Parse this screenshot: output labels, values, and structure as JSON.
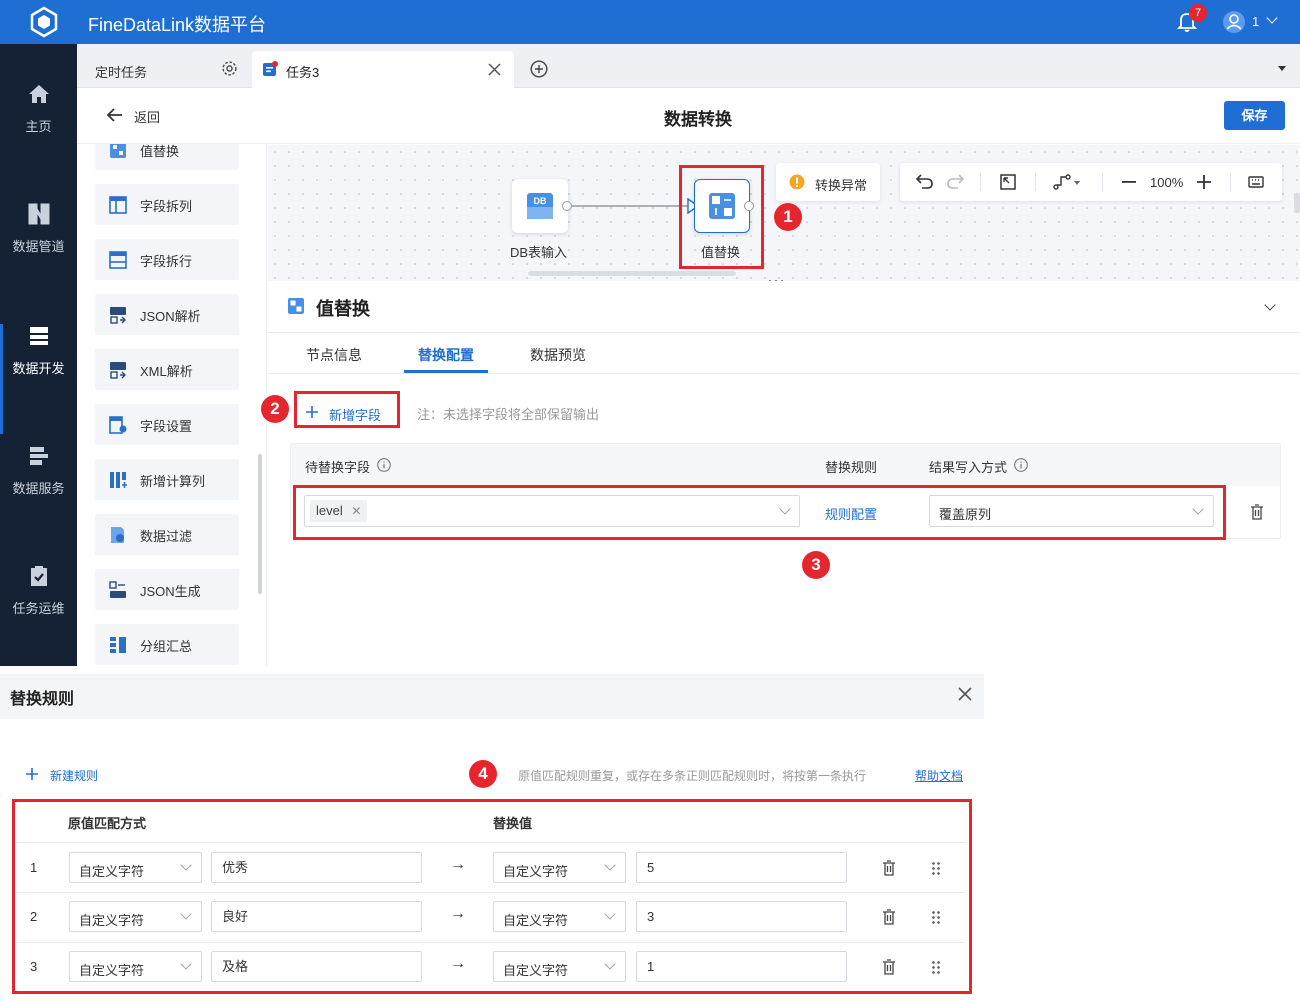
{
  "app": {
    "title": "FineDataLink数据平台",
    "notification_count": "7",
    "user": "1"
  },
  "nav": {
    "items": [
      {
        "label": "主页",
        "icon": "home-icon"
      },
      {
        "label": "数据管道",
        "icon": "pipeline-icon"
      },
      {
        "label": "数据开发",
        "icon": "dev-icon",
        "active": true
      },
      {
        "label": "数据服务",
        "icon": "service-icon"
      },
      {
        "label": "任务运维",
        "icon": "ops-icon"
      }
    ]
  },
  "tabs": {
    "items": [
      {
        "label": "定时任务"
      },
      {
        "label": "任务3"
      }
    ]
  },
  "subhead": {
    "back": "返回",
    "title": "数据转换",
    "save": "保存"
  },
  "palette": {
    "items": [
      {
        "label": "值替换"
      },
      {
        "label": "字段拆列"
      },
      {
        "label": "字段拆行"
      },
      {
        "label": "JSON解析"
      },
      {
        "label": "XML解析"
      },
      {
        "label": "字段设置"
      },
      {
        "label": "新增计算列"
      },
      {
        "label": "数据过滤"
      },
      {
        "label": "JSON生成"
      },
      {
        "label": "分组汇总"
      }
    ]
  },
  "canvas": {
    "node1": {
      "label": "DB表输入",
      "icon_text": "DB"
    },
    "node2": {
      "label": "值替换"
    },
    "warning": "转换异常",
    "zoom": "100%"
  },
  "config": {
    "title": "值替换",
    "tabs": [
      {
        "label": "节点信息"
      },
      {
        "label": "替换配置"
      },
      {
        "label": "数据预览"
      }
    ],
    "add_field": "新增字段",
    "note": "注：未选择字段将全部保留输出",
    "col_field": "待替换字段",
    "col_rule": "替换规则",
    "col_write": "结果写入方式",
    "field_tag": "level",
    "rule_link": "规则配置",
    "write_mode": "覆盖原列"
  },
  "dialog": {
    "title": "替换规则",
    "new_rule": "新建规则",
    "hint": "原值匹配规则重复，或存在多条正则匹配规则时，将按第一条执行",
    "help": "帮助文档",
    "col_match": "原值匹配方式",
    "col_replace": "替换值",
    "rows": [
      {
        "index": "1",
        "match_mode": "自定义字符",
        "match_value": "优秀",
        "replace_mode": "自定义字符",
        "replace_value": "5"
      },
      {
        "index": "2",
        "match_mode": "自定义字符",
        "match_value": "良好",
        "replace_mode": "自定义字符",
        "replace_value": "3"
      },
      {
        "index": "3",
        "match_mode": "自定义字符",
        "match_value": "及格",
        "replace_mode": "自定义字符",
        "replace_value": "1"
      }
    ]
  },
  "badges": [
    "1",
    "2",
    "3",
    "4"
  ],
  "colors": {
    "primary": "#1f6ed4",
    "nav_bg": "#152235",
    "highlight": "#e5262e"
  }
}
